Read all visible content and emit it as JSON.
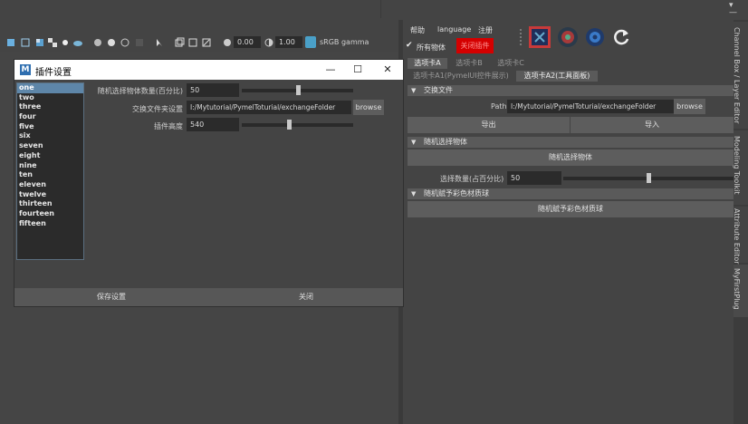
{
  "viewport_toolbar": {
    "exposure_value": "0.00",
    "gamma_value": "1.00",
    "colorspace_label": "sRGB gamma"
  },
  "dialog": {
    "title": "插件设置",
    "list_items": [
      "one",
      "two",
      "three",
      "four",
      "five",
      "six",
      "seven",
      "eight",
      "nine",
      "ten",
      "eleven",
      "twelve",
      "thirteen",
      "fourteen",
      "fifteen"
    ],
    "selected_index": 0,
    "rows": [
      {
        "label": "随机选择物体数量(百分比)",
        "value": "50",
        "slider_fraction": 0.5
      },
      {
        "label": "交换文件夹设置",
        "value": "I:/Mytutorial/PymelToturial/exchangeFolder",
        "button": "browse"
      },
      {
        "label": "插件高度",
        "value": "540",
        "slider_fraction": 0.42
      }
    ],
    "save_label": "保存设置",
    "close_label": "关闭"
  },
  "right_panel": {
    "menus": [
      "帮助",
      "language",
      "注册"
    ],
    "checkbox_label": "所有物体",
    "close_plugin_label": "关闭插件",
    "tabs": [
      "选项卡A",
      "选项卡B",
      "选项卡C"
    ],
    "subtabs": [
      "选项卡A1(PymelUI控件展示)",
      "选项卡A2(工具面板)"
    ],
    "sections": {
      "exchange": {
        "title": "交换文件",
        "path_label": "Path",
        "path_value": "I:/Mytutorial/PymelToturial/exchangeFolder",
        "browse_label": "browse",
        "export_label": "导出",
        "import_label": "导入"
      },
      "random_select": {
        "title": "随机选择物体",
        "button_label": "随机选择物体",
        "count_label": "选择数量(占百分比)",
        "count_value": "50",
        "slider_fraction": 0.5
      },
      "random_material": {
        "title": "随机赋予彩色材质球",
        "button_label": "随机赋予彩色材质球"
      }
    }
  },
  "side_tabs": [
    "Channel Box / Layer Editor",
    "Modeling Toolkit",
    "Attribute Editor",
    "MyFirstPlug"
  ],
  "colors": {
    "close_plugin_bg": "#d40000",
    "selection": "#5e86a8"
  }
}
